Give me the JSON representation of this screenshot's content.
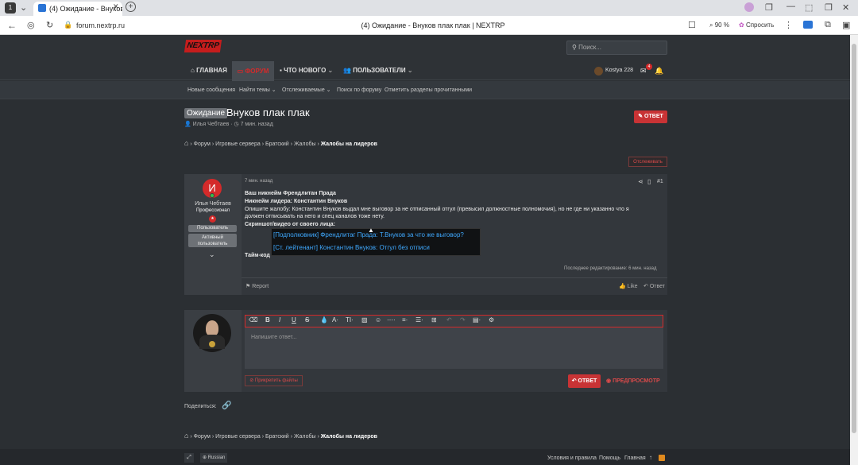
{
  "browser": {
    "tab_count": "1",
    "tab_title": "(4) Ожидание - Внуков п",
    "url": "forum.nextrp.ru",
    "window_title": "(4) Ожидание - Внуков плак плак | NEXTRP",
    "zoom": "90 %",
    "ask_label": "Спросить"
  },
  "site": {
    "logo": "NEXTRP",
    "search_placeholder": "Поиск..."
  },
  "nav": {
    "home": "ГЛАВНАЯ",
    "forum": "ФОРУМ",
    "whats_new": "ЧТО НОВОГО",
    "users": "ПОЛЬЗОВАТЕЛИ",
    "username": "Kostya 228",
    "inbox_count": "4"
  },
  "subnav": [
    "Новые сообщения",
    "Найти темы",
    "Отслеживаемые",
    "Поиск по форуму",
    "Отметить разделы прочитанными"
  ],
  "thread": {
    "badge": "Ожидание",
    "title": "Внуков плак плак",
    "author": "Илья Чебтаев",
    "time": "7 мин. назад",
    "reply_button": "ОТВЕТ",
    "watch_button": "Отслеживать"
  },
  "breadcrumbs": [
    "Форум",
    "Игровые сервера",
    "Братский",
    "Жалобы",
    "Жалобы на лидеров"
  ],
  "post": {
    "avatar_letter": "И",
    "user_name": "Илья Чебтаев",
    "user_title": "Профессионал",
    "role_1": "Пользователь",
    "role_2": "Активный пользователь",
    "time": "7 мин. назад",
    "number": "#1",
    "lines": [
      "Ваш никнейм Френдлитан Прада",
      "Никнейм лидера: Константин Внуков",
      "Опишите жалобу: Константин Внуков выдал мне выговор за не отписанный отгул (превысил должностные полномочия), но не где ни указанно что я",
      "должен отписывать на него и спец каналов тоже нету.",
      "Скриншот/видео от своего лица:",
      "Тайм-код"
    ],
    "tooltip_lines": [
      "[Подполковник] Френдлитаг Прада: Т.Внуков за что же выговор?",
      "[Ст. лейтенант] Константин Внуков: Отгул без отписи"
    ],
    "edited": "Последнее редактирование: 6 мин. назад",
    "report": "Report",
    "like": "Like",
    "reply": "Ответ"
  },
  "editor": {
    "placeholder": "Напишите ответ...",
    "attach": "Прикрепить файлы",
    "submit": "ОТВЕТ",
    "preview": "ПРЕДПРОСМОТР"
  },
  "share_label": "Поделиться:",
  "footer": {
    "language": "Russian",
    "terms": "Условия и правила",
    "help": "Помощь",
    "home": "Главная"
  },
  "colors": {
    "accent_red": "#c83335",
    "link_blue": "#3fa9ff",
    "background": "#2b2f33"
  }
}
